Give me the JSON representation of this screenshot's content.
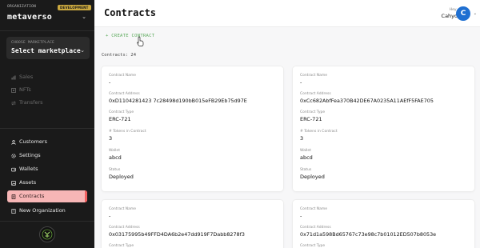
{
  "sidebar": {
    "org_label": "ORGANIZATION",
    "org_badge": "DEVELOPMENT",
    "org_name": "metaverso",
    "marketplace_label": "CHOOSE MARKETPLACE",
    "marketplace_value": "Select marketplace",
    "items_disabled": [
      {
        "label": "Sales",
        "icon": "chart-icon"
      },
      {
        "label": "NFTs",
        "icon": "nft-icon"
      },
      {
        "label": "Transfers",
        "icon": "transfer-icon"
      }
    ],
    "items": [
      {
        "label": "Customers",
        "icon": "user-icon"
      },
      {
        "label": "Settings",
        "icon": "gear-icon"
      },
      {
        "label": "Wallets",
        "icon": "wallet-icon"
      },
      {
        "label": "Assets",
        "icon": "assets-icon"
      },
      {
        "label": "Contracts",
        "icon": "contract-icon",
        "active": true
      },
      {
        "label": "New Organization",
        "icon": "building-icon"
      }
    ]
  },
  "header": {
    "title": "Contracts",
    "greeting": "Hey,",
    "user_name": "Cahyo",
    "avatar_initial": "C"
  },
  "main": {
    "create_label": "+ CREATE CONTRACT",
    "count_text": "Contracts: 24",
    "field_labels": {
      "name": "Contract Name",
      "address": "Contract Address",
      "type": "Contract Type",
      "tokens": "# Tokens in Contract",
      "wallet": "Wallet",
      "status": "Status"
    },
    "cards": [
      {
        "name": "-",
        "address": "0xD1104281423 7c28498d190bB015eFB29Eb75d97E",
        "type": "ERC-721",
        "tokens": "3",
        "wallet": "abcd",
        "status": "Deployed"
      },
      {
        "name": "-",
        "address": "0xCc682AbfFea370B42DE67A0235A11AEfF5FAE705",
        "type": "ERC-721",
        "tokens": "3",
        "wallet": "abcd",
        "status": "Deployed"
      },
      {
        "name": "-",
        "address": "0x03175995b49FFD4DA6b2e47dd919F7Dabb8278f3",
        "type": "",
        "tokens": "",
        "wallet": "",
        "status": ""
      },
      {
        "name": "-",
        "address": "0x71d1a598Bd65767c73e98c7b01012ED507b8053e",
        "type": "",
        "tokens": "",
        "wallet": "",
        "status": ""
      }
    ]
  },
  "colors": {
    "sidebar_bg": "#1a1a1a",
    "active_bg": "#f7b6b6",
    "active_bar": "#f26060",
    "accent_green": "#5aa95a",
    "avatar_blue": "#1f6fd1",
    "badge_gold": "#caa83f"
  }
}
